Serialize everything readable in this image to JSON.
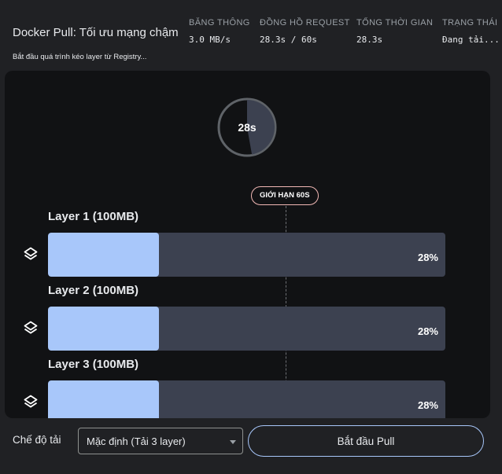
{
  "header": {
    "title": "Docker Pull: Tối ưu mạng chậm",
    "subtitle": "Bắt đầu quá trình kéo layer từ Registry...",
    "stats": [
      {
        "label": "BĂNG THÔNG",
        "value": "3.0 MB/s"
      },
      {
        "label": "ĐỒNG HỒ REQUEST",
        "value": "28.3s / 60s"
      },
      {
        "label": "TỔNG THỜI GIAN",
        "value": "28.3s"
      },
      {
        "label": "TRẠNG THÁI",
        "value": "Đang tải..."
      }
    ]
  },
  "timer": {
    "label": "28s",
    "progress": 0.472
  },
  "limit": {
    "label": "GIỚI HẠN 60S"
  },
  "layers": [
    {
      "name": "Layer 1 (100MB)",
      "percent_label": "28%",
      "progress": 0.28
    },
    {
      "name": "Layer 2 (100MB)",
      "percent_label": "28%",
      "progress": 0.28
    },
    {
      "name": "Layer 3 (100MB)",
      "percent_label": "28%",
      "progress": 0.28
    }
  ],
  "footer": {
    "mode_label": "Chế độ tải",
    "mode_value": "Mặc định (Tải 3 layer)",
    "start_button": "Bắt đầu Pull"
  },
  "colors": {
    "background": "#202124",
    "panel": "#111214",
    "bar_track": "#3c4150",
    "bar_fill": "#a8c7fa",
    "limit_border": "#f2b8b5",
    "timer_fill": "#3c4150"
  },
  "icons": {
    "layer": "layers-icon",
    "caret": "chevron-down-icon"
  }
}
